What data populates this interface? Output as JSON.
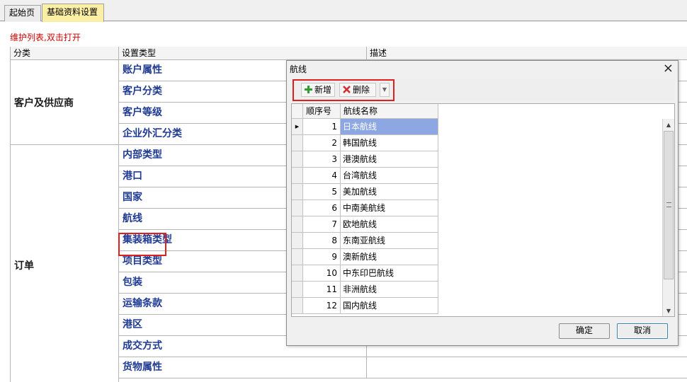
{
  "tabs": [
    "起始页",
    "基础资料设置"
  ],
  "hint": "维护列表,双击打开",
  "grid": {
    "headers": [
      "分类",
      "设置类型",
      "描述"
    ],
    "categories": [
      "客户及供应商",
      "订单"
    ],
    "types": [
      "账户属性",
      "客户分类",
      "客户等级",
      "企业外汇分类",
      "内部类型",
      "港口",
      "国家",
      "航线",
      "集装箱类型",
      "项目类型",
      "包装",
      "运输条款",
      "港区",
      "成交方式",
      "货物属性"
    ]
  },
  "dialog": {
    "title": "航线",
    "close": "×",
    "toolbar": {
      "add": "新增",
      "delete": "删除"
    },
    "headers": [
      "顺序号",
      "航线名称"
    ],
    "rows": [
      {
        "seq": "1",
        "name": "日本航线"
      },
      {
        "seq": "2",
        "name": "韩国航线"
      },
      {
        "seq": "3",
        "name": "港澳航线"
      },
      {
        "seq": "4",
        "name": "台湾航线"
      },
      {
        "seq": "5",
        "name": "美加航线"
      },
      {
        "seq": "6",
        "name": "中南美航线"
      },
      {
        "seq": "7",
        "name": "欧地航线"
      },
      {
        "seq": "8",
        "name": "东南亚航线"
      },
      {
        "seq": "9",
        "name": "澳新航线"
      },
      {
        "seq": "10",
        "name": "中东印巴航线"
      },
      {
        "seq": "11",
        "name": "非洲航线"
      },
      {
        "seq": "12",
        "name": "国内航线"
      }
    ],
    "ok": "确定",
    "cancel": "取消"
  },
  "colors": {
    "highlight_border": "#e02020",
    "hint_text": "#d40000",
    "selected_row": "#8da7e2",
    "type_text": "#1f3a93"
  }
}
